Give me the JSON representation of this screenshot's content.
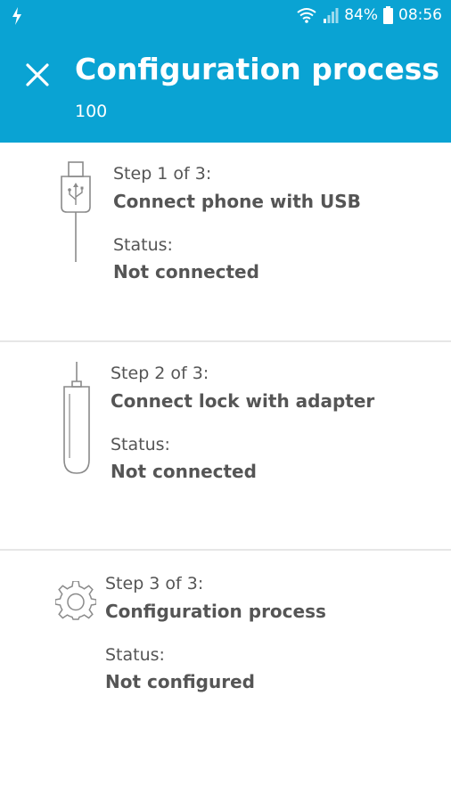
{
  "status_bar": {
    "battery": "84%",
    "time": "08:56"
  },
  "header": {
    "title": "Configuration process",
    "subtitle": "100"
  },
  "steps": [
    {
      "step_label": "Step 1 of 3:",
      "step_name": "Connect phone with USB",
      "status_label": "Status:",
      "status_value": "Not connected",
      "icon": "usb-cable-icon"
    },
    {
      "step_label": "Step 2 of 3:",
      "step_name": "Connect lock with adapter",
      "status_label": "Status:",
      "status_value": "Not connected",
      "icon": "adapter-icon"
    },
    {
      "step_label": "Step 3 of 3:",
      "step_name": "Configuration process",
      "status_label": "Status:",
      "status_value": "Not configured",
      "icon": "gear-icon"
    }
  ],
  "colors": {
    "accent": "#0aa3d3",
    "text": "#555555",
    "divider": "#e6e6e6"
  }
}
